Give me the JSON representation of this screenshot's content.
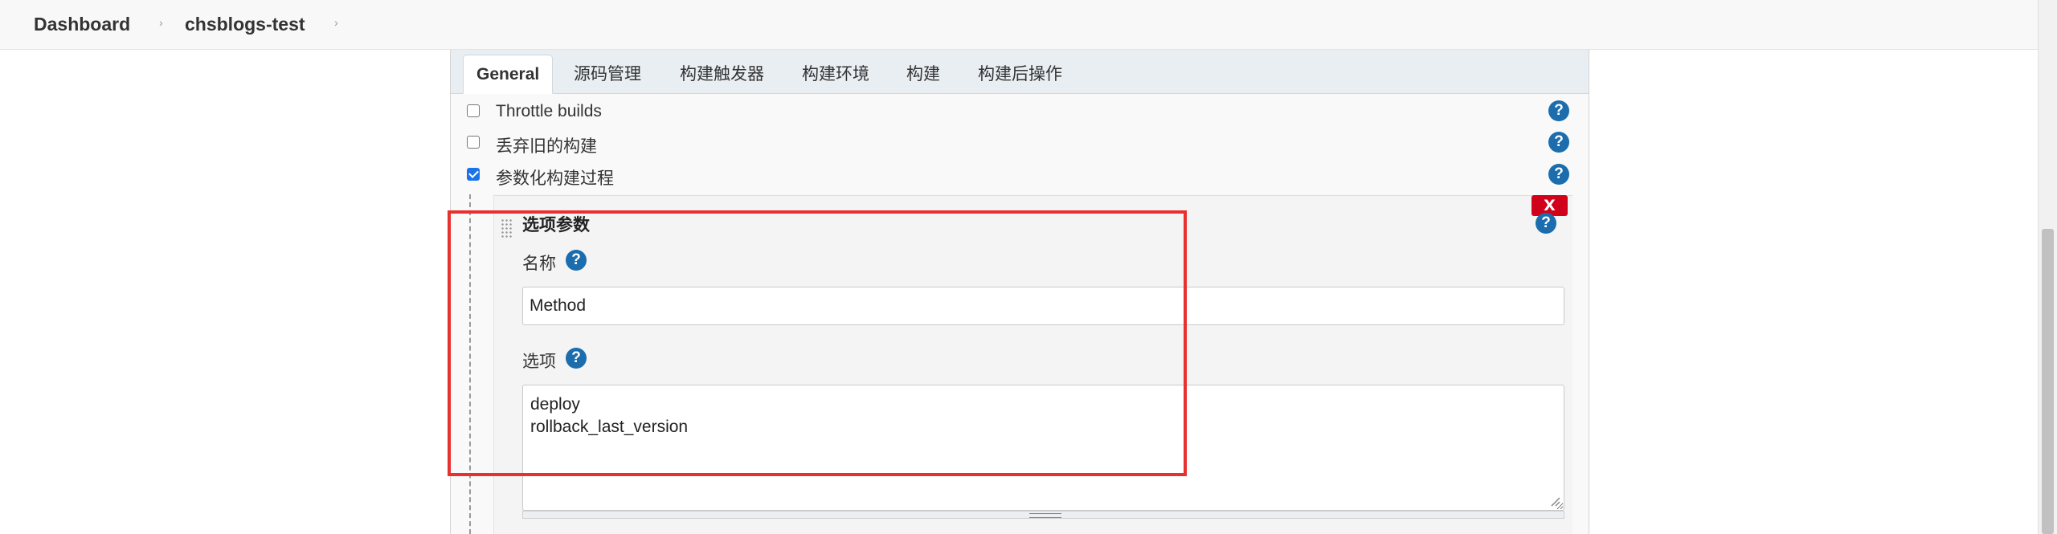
{
  "breadcrumb": {
    "items": [
      "Dashboard",
      "chsblogs-test"
    ],
    "separator": "›"
  },
  "tabs": [
    {
      "label": "General",
      "active": true
    },
    {
      "label": "源码管理",
      "active": false
    },
    {
      "label": "构建触发器",
      "active": false
    },
    {
      "label": "构建环境",
      "active": false
    },
    {
      "label": "构建",
      "active": false
    },
    {
      "label": "构建后操作",
      "active": false
    }
  ],
  "options": [
    {
      "label": "Throttle builds",
      "checked": false
    },
    {
      "label": "丢弃旧的构建",
      "checked": false
    },
    {
      "label": "参数化构建过程",
      "checked": true
    }
  ],
  "help_glyph": "?",
  "parameter": {
    "title": "选项参数",
    "delete_label": "X",
    "name_label": "名称",
    "name_value": "Method",
    "choices_label": "选项",
    "choices_value": "deploy\nrollback_last_version"
  },
  "colors": {
    "help": "#1b6dad",
    "delete": "#d0021b",
    "highlight": "#e8302f",
    "checkbox_checked": "#1a73e8"
  }
}
